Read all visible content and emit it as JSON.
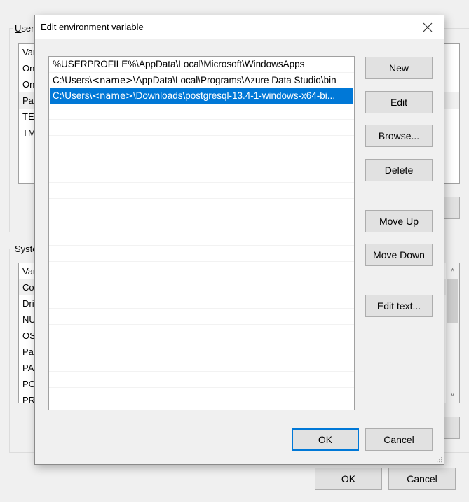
{
  "background_window": {
    "user_group_label_accel": "U",
    "user_group_label_rest": "ser",
    "user_list_rows": [
      "Var",
      "On",
      "On",
      "Pat",
      "TEI",
      "TM"
    ],
    "user_list_highlight_index": 3,
    "system_group_label_accel": "S",
    "system_group_label_rest": "yste",
    "system_list_rows": [
      "Var",
      "Co",
      "Dri",
      "NU",
      "OS",
      "Pat",
      "PA",
      "PO",
      "PR"
    ],
    "system_list_highlight_index": 1,
    "ok_label": "OK",
    "cancel_label": "Cancel"
  },
  "dialog": {
    "title": "Edit environment variable",
    "close_icon": "close-icon",
    "paths": [
      {
        "prefix": "%USERPROFILE%\\AppData\\Local\\Microsoft\\WindowsApps",
        "name": "",
        "suffix": ""
      },
      {
        "prefix": "C:\\Users\\",
        "name": "<name>",
        "suffix": "\\AppData\\Local\\Programs\\Azure Data Studio\\bin"
      },
      {
        "prefix": "C:\\Users\\",
        "name": "<name>",
        "suffix": "\\Downloads\\postgresql-13.4-1-windows-x64-bi..."
      }
    ],
    "selected_index": 2,
    "empty_rows": 19,
    "buttons": {
      "new": "New",
      "edit": "Edit",
      "browse": "Browse...",
      "delete": "Delete",
      "move_up": "Move Up",
      "move_down": "Move Down",
      "edit_text": "Edit text...",
      "ok": "OK",
      "cancel": "Cancel"
    },
    "colors": {
      "selection": "#0078d7",
      "default_button_border": "#0078d7"
    }
  }
}
